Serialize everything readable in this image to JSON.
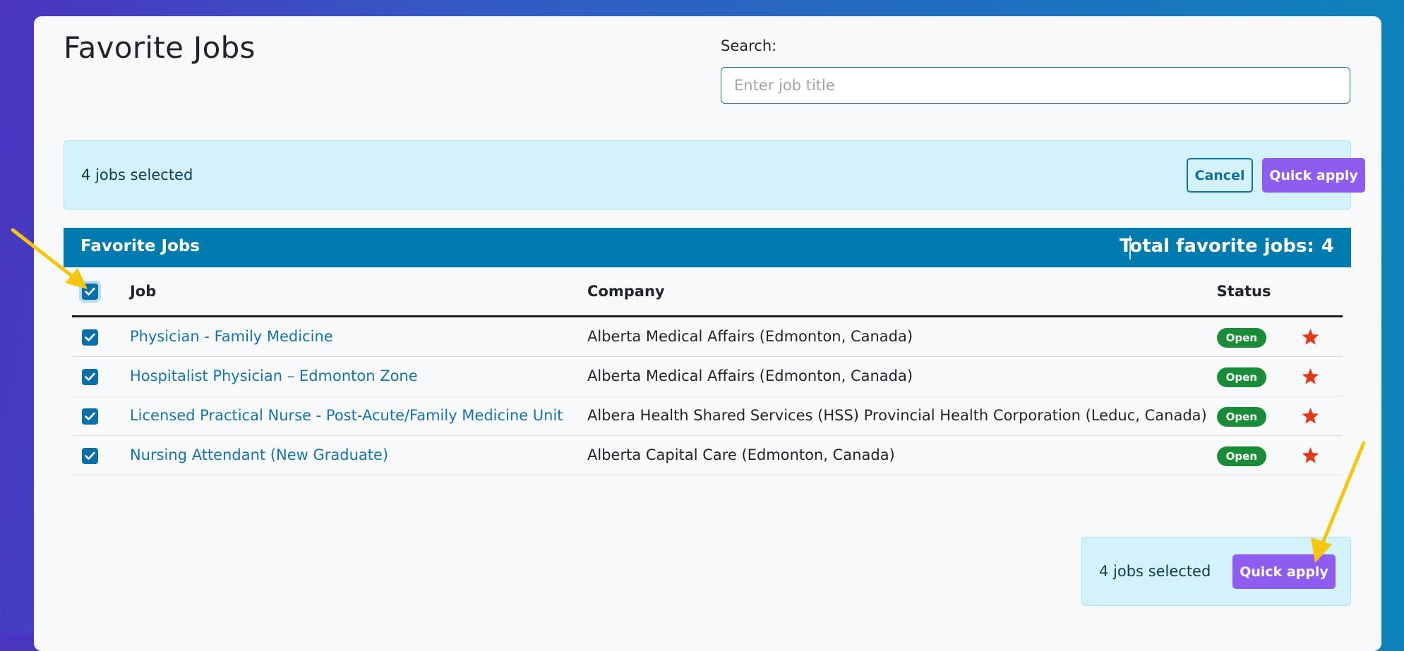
{
  "page": {
    "title": "Favorite Jobs"
  },
  "search": {
    "label": "Search:",
    "placeholder": "Enter job title",
    "value": ""
  },
  "selection_bar": {
    "count_text": "4 jobs selected",
    "cancel_label": "Cancel",
    "quick_apply_label": "Quick apply"
  },
  "table_header": {
    "title": "Favorite Jobs",
    "total_label": "Total favorite jobs:",
    "total_count": "4"
  },
  "columns": {
    "job": "Job",
    "company": "Company",
    "status": "Status"
  },
  "rows": [
    {
      "job": "Physician - Family Medicine",
      "company": "Alberta Medical Affairs (Edmonton, Canada)",
      "status": "Open",
      "selected": true,
      "favorite": true
    },
    {
      "job": "Hospitalist Physician – Edmonton Zone",
      "company": "Alberta Medical Affairs (Edmonton, Canada)",
      "status": "Open",
      "selected": true,
      "favorite": true
    },
    {
      "job": "Licensed Practical Nurse - Post-Acute/Family Medicine Unit",
      "company": "Albera Health Shared Services (HSS) Provincial Health Corporation (Leduc, Canada)",
      "status": "Open",
      "selected": true,
      "favorite": true
    },
    {
      "job": "Nursing Attendant (New Graduate)",
      "company": "Alberta Capital Care (Edmonton, Canada)",
      "status": "Open",
      "selected": true,
      "favorite": true
    }
  ],
  "bottom_bar": {
    "count_text": "4 jobs selected",
    "quick_apply_label": "Quick apply"
  },
  "icons": {
    "checkbox": "check-icon",
    "favorite": "star-icon",
    "annotation": "arrow-icon"
  },
  "colors": {
    "primary": "#007bb0",
    "accent_button": "#8f5cf2",
    "status_open": "#198c38",
    "star": "#e0391b",
    "annotation_arrow": "#f6c60f",
    "selection_bg": "#d3f2fc"
  }
}
